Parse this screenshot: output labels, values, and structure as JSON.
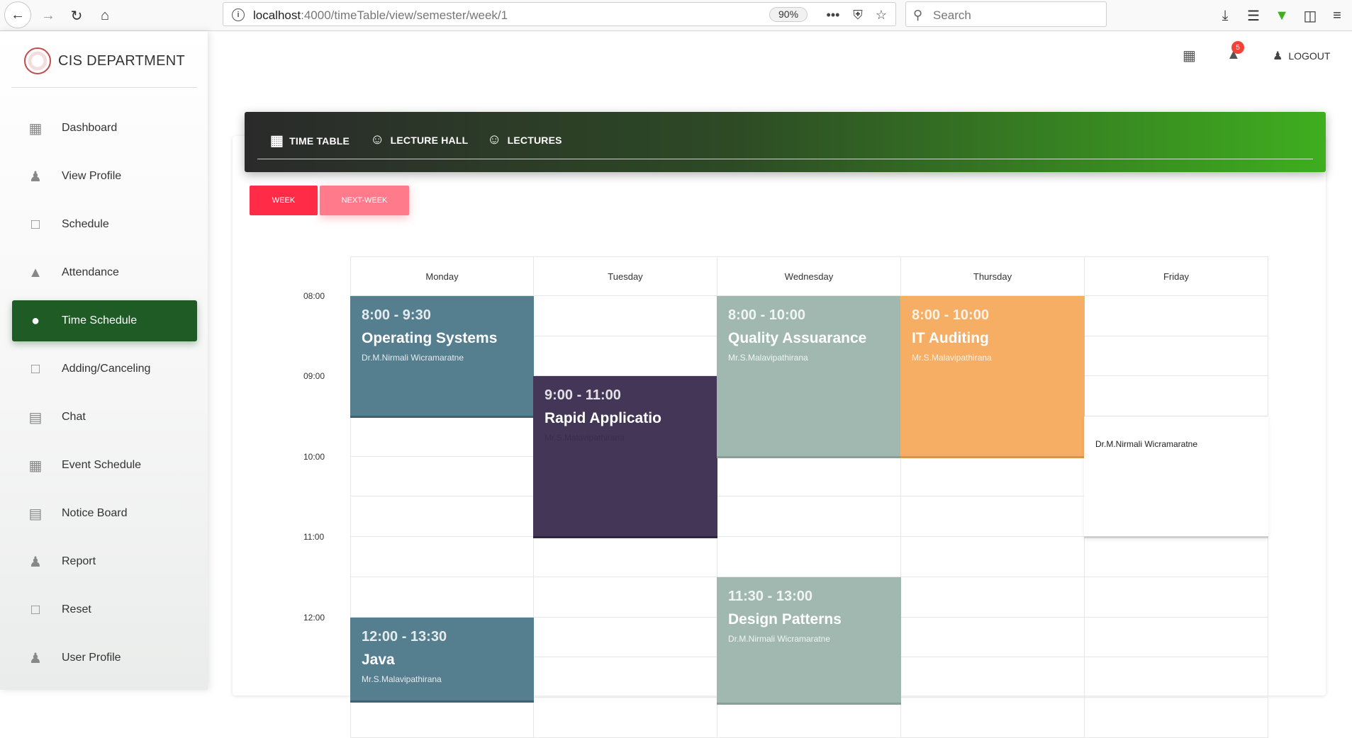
{
  "browser": {
    "url_host": "localhost",
    "url_path": ":4000/timeTable/view/semester/week/1",
    "zoom": "90%",
    "search_placeholder": "Search"
  },
  "sidebar": {
    "brand": "CIS DEPARTMENT",
    "items": [
      {
        "label": "Dashboard",
        "icon": "dashboard-icon",
        "active": false
      },
      {
        "label": "View Profile",
        "icon": "person-icon",
        "active": false
      },
      {
        "label": "Schedule",
        "icon": "clipboard-icon",
        "active": false
      },
      {
        "label": "Attendance",
        "icon": "bell-icon",
        "active": false
      },
      {
        "label": "Time Schedule",
        "icon": "bubbles-icon",
        "active": true
      },
      {
        "label": "Adding/Canceling",
        "icon": "clipboard-icon",
        "active": false
      },
      {
        "label": "Chat",
        "icon": "library-icon",
        "active": false
      },
      {
        "label": "Event Schedule",
        "icon": "dashboard-icon",
        "active": false
      },
      {
        "label": "Notice Board",
        "icon": "library-icon",
        "active": false
      },
      {
        "label": "Report",
        "icon": "person-icon",
        "active": false
      },
      {
        "label": "Reset",
        "icon": "clipboard-icon",
        "active": false
      },
      {
        "label": "User Profile",
        "icon": "person-icon",
        "active": false
      }
    ]
  },
  "topbar": {
    "notification_count": "5",
    "logout_label": "LOGOUT"
  },
  "tabs": [
    {
      "label": "TIME TABLE",
      "icon": "dashboard-icon"
    },
    {
      "label": "LECTURE HALL",
      "icon": "face-icon"
    },
    {
      "label": "LECTURES",
      "icon": "face-icon"
    }
  ],
  "buttons": {
    "week": "WEEK",
    "next_week": "NEXT-WEEK"
  },
  "timetable": {
    "days": [
      "Monday",
      "Tuesday",
      "Wednesday",
      "Thursday",
      "Friday"
    ],
    "times": [
      "08:00",
      "09:00",
      "10:00",
      "11:00",
      "12:00"
    ],
    "events": [
      {
        "time": "8:00 - 9:30",
        "title": "Operating Systems",
        "lecturer": "Dr.M.Nirmali Wicramaratne",
        "color": "#557e8f"
      },
      {
        "time": "9:00 - 11:00",
        "title": "Rapid Applicatio",
        "lecturer": "Mr.S.Malavipathirana",
        "color": "#433657"
      },
      {
        "time": "8:00 - 10:00",
        "title": "Quality Assuarance",
        "lecturer": "Mr.S.Malavipathirana",
        "color": "#a0b8b0"
      },
      {
        "time": "8:00 - 10:00",
        "title": "IT Auditing",
        "lecturer": "Mr.S.Malavipathirana",
        "color": "#f5ae63"
      },
      {
        "time": "",
        "title": "",
        "lecturer": "Dr.M.Nirmali Wicramaratne",
        "color": "#ffffff"
      },
      {
        "time": "11:30 - 13:00",
        "title": "Design Patterns",
        "lecturer": "Dr.M.Nirmali Wicramaratne",
        "color": "#a0b8b0"
      },
      {
        "time": "12:00 - 13:30",
        "title": "Java",
        "lecturer": "Mr.S.Malavipathirana",
        "color": "#557e8f"
      }
    ]
  }
}
